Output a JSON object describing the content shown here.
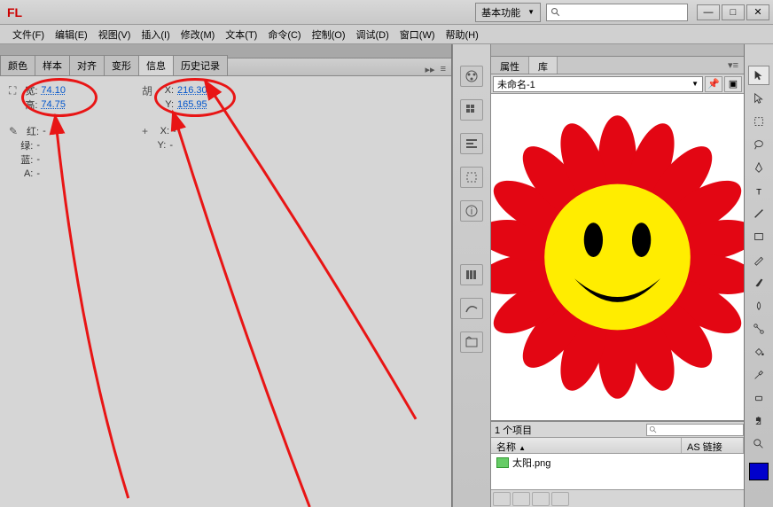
{
  "titlebar": {
    "logo": "FL",
    "workspace_dd": "基本功能"
  },
  "menubar": [
    {
      "label": "文件(F)"
    },
    {
      "label": "编辑(E)"
    },
    {
      "label": "视图(V)"
    },
    {
      "label": "插入(I)"
    },
    {
      "label": "修改(M)"
    },
    {
      "label": "文本(T)"
    },
    {
      "label": "命令(C)"
    },
    {
      "label": "控制(O)"
    },
    {
      "label": "调试(D)"
    },
    {
      "label": "窗口(W)"
    },
    {
      "label": "帮助(H)"
    }
  ],
  "doc_tab": "未命名-1",
  "panel_tabs": [
    {
      "label": "颜色"
    },
    {
      "label": "样本"
    },
    {
      "label": "对齐"
    },
    {
      "label": "变形"
    },
    {
      "label": "信息",
      "active": true
    },
    {
      "label": "历史记录"
    }
  ],
  "info": {
    "width_label": "宽:",
    "width_val": "74.10",
    "height_label": "高:",
    "height_val": "74.75",
    "x_label": "X:",
    "x_val": "216.30",
    "y_label": "Y:",
    "y_val": "165.95",
    "r_label": "红:",
    "r_val": "-",
    "g_label": "绿:",
    "g_val": "-",
    "b_label": "蓝:",
    "b_val": "-",
    "a_label": "A:",
    "a_val": "-",
    "x2_label": "X:",
    "x2_val": "-",
    "y2_label": "Y:",
    "y2_val": "-"
  },
  "right": {
    "tabs": [
      {
        "label": "属性"
      },
      {
        "label": "库",
        "active": true
      }
    ],
    "doc_name": "未命名-1",
    "item_count": "1 个项目",
    "col_name": "名称",
    "col_link": "AS 链接",
    "item1": "太阳.png"
  }
}
